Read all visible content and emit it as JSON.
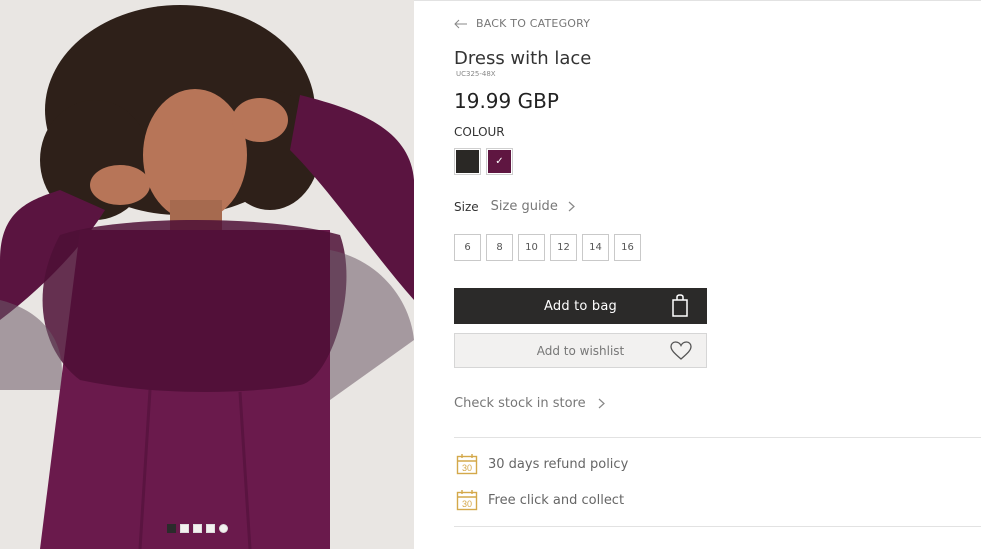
{
  "gallery": {
    "dots": [
      {
        "state": "active",
        "shape": "square"
      },
      {
        "state": "inactive",
        "shape": "square"
      },
      {
        "state": "inactive",
        "shape": "square"
      },
      {
        "state": "inactive",
        "shape": "square"
      },
      {
        "state": "inactive",
        "shape": "round"
      }
    ]
  },
  "product": {
    "back_label": "BACK TO CATEGORY",
    "title": "Dress with lace",
    "sku": "UC325-48X",
    "price": "19.99 GBP",
    "colour_label": "COLOUR",
    "colours": [
      {
        "name": "black",
        "hex": "#2a2825",
        "selected": false
      },
      {
        "name": "plum",
        "hex": "#5f1641",
        "selected": true,
        "check": "✓"
      }
    ],
    "size_label": "Size",
    "size_guide_label": "Size guide",
    "sizes": [
      "6",
      "8",
      "10",
      "12",
      "14",
      "16"
    ],
    "add_to_bag_label": "Add to bag",
    "add_to_wishlist_label": "Add to wishlist",
    "check_stock_label": "Check stock in store",
    "perks": [
      {
        "icon": "calendar-30-icon",
        "calendar_number": "30",
        "label": "30 days refund policy"
      },
      {
        "icon": "calendar-30-icon",
        "calendar_number": "30",
        "label": "Free click and collect"
      }
    ]
  },
  "colors": {
    "accent_dark": "#2b2a29",
    "perk_icon": "#d4a84a",
    "dress": "#6a1a4c"
  }
}
